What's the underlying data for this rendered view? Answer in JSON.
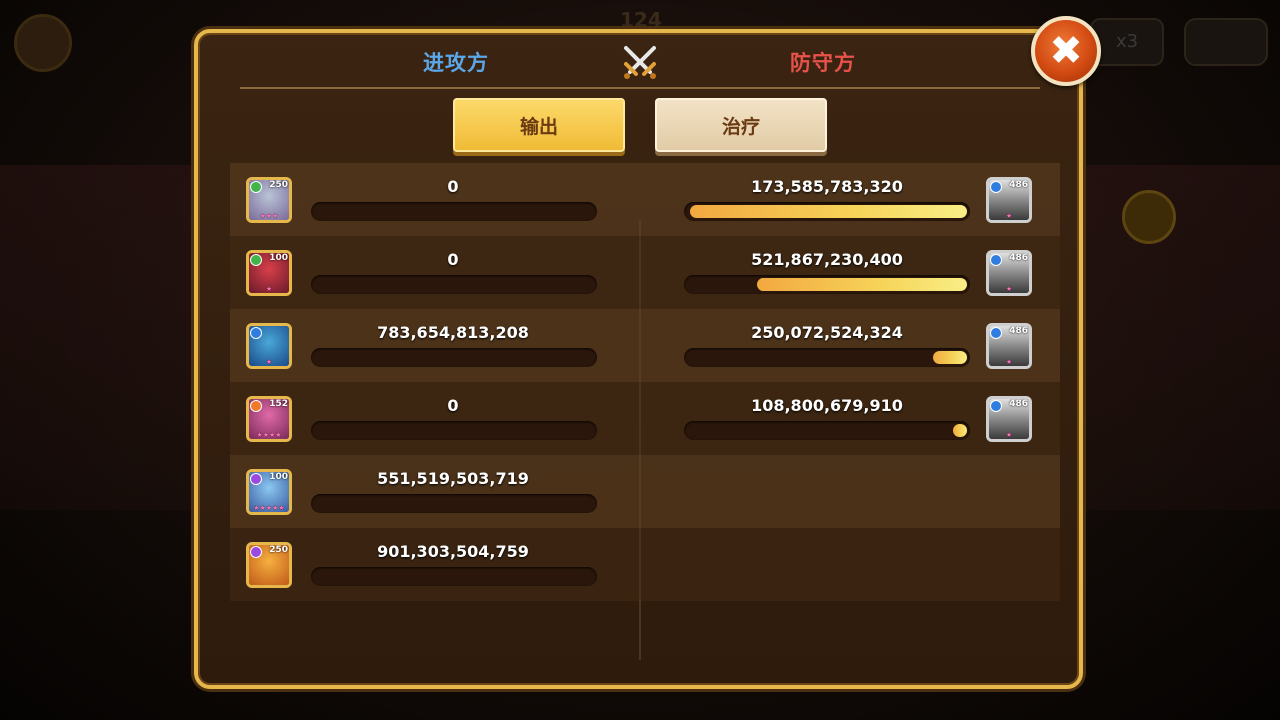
{
  "background": {
    "round_counter": "124",
    "speed_label": "x3"
  },
  "header": {
    "attacker_label": "进攻方",
    "defender_label": "防守方",
    "crossed_swords_icon": "crossed-swords-icon"
  },
  "close_icon": "close-icon",
  "tabs": {
    "output_label": "输出",
    "heal_label": "治疗",
    "active": "output"
  },
  "colors": {
    "accent_gold": "#e6b74a",
    "attacker_blue": "#5aa7ea",
    "defender_red": "#e8524a",
    "bar_fill": "#f6d45a"
  },
  "attackers": [
    {
      "level": "250",
      "value": "0",
      "fill": 0,
      "element": "green",
      "stars": "★★★"
    },
    {
      "level": "100",
      "value": "0",
      "fill": 0,
      "element": "green",
      "stars": "★"
    },
    {
      "level": "",
      "value": "783,654,813,208",
      "fill": 0,
      "element": "blue",
      "stars": "★"
    },
    {
      "level": "152",
      "value": "0",
      "fill": 0,
      "element": "orange",
      "stars": "★★★★"
    },
    {
      "level": "100",
      "value": "551,519,503,719",
      "fill": 0,
      "element": "purple",
      "stars": "★★★★★"
    },
    {
      "level": "250",
      "value": "901,303,504,759",
      "fill": 0,
      "element": "purple",
      "stars": ""
    }
  ],
  "defenders": [
    {
      "level": "486",
      "value": "173,585,783,320",
      "fill": 0.99,
      "element": "blue",
      "stars": "★"
    },
    {
      "level": "486",
      "value": "521,867,230,400",
      "fill": 0.75,
      "element": "blue",
      "stars": "★"
    },
    {
      "level": "486",
      "value": "250,072,524,324",
      "fill": 0.12,
      "element": "blue",
      "stars": "★"
    },
    {
      "level": "486",
      "value": "108,800,679,910",
      "fill": 0.05,
      "element": "blue",
      "stars": "★"
    }
  ]
}
